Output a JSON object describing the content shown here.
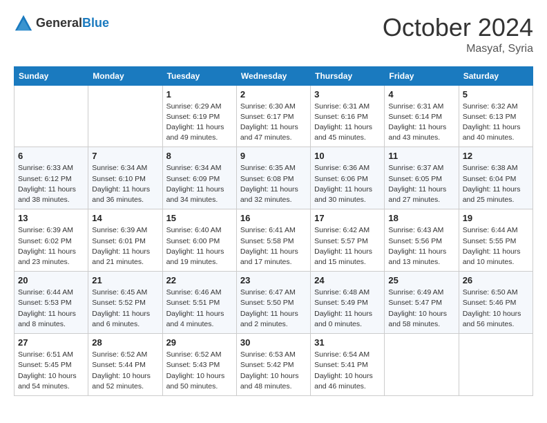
{
  "logo": {
    "general": "General",
    "blue": "Blue"
  },
  "title": "October 2024",
  "location": "Masyaf, Syria",
  "weekdays": [
    "Sunday",
    "Monday",
    "Tuesday",
    "Wednesday",
    "Thursday",
    "Friday",
    "Saturday"
  ],
  "weeks": [
    [
      {
        "day": "",
        "sunrise": "",
        "sunset": "",
        "daylight": ""
      },
      {
        "day": "",
        "sunrise": "",
        "sunset": "",
        "daylight": ""
      },
      {
        "day": "1",
        "sunrise": "Sunrise: 6:29 AM",
        "sunset": "Sunset: 6:19 PM",
        "daylight": "Daylight: 11 hours and 49 minutes."
      },
      {
        "day": "2",
        "sunrise": "Sunrise: 6:30 AM",
        "sunset": "Sunset: 6:17 PM",
        "daylight": "Daylight: 11 hours and 47 minutes."
      },
      {
        "day": "3",
        "sunrise": "Sunrise: 6:31 AM",
        "sunset": "Sunset: 6:16 PM",
        "daylight": "Daylight: 11 hours and 45 minutes."
      },
      {
        "day": "4",
        "sunrise": "Sunrise: 6:31 AM",
        "sunset": "Sunset: 6:14 PM",
        "daylight": "Daylight: 11 hours and 43 minutes."
      },
      {
        "day": "5",
        "sunrise": "Sunrise: 6:32 AM",
        "sunset": "Sunset: 6:13 PM",
        "daylight": "Daylight: 11 hours and 40 minutes."
      }
    ],
    [
      {
        "day": "6",
        "sunrise": "Sunrise: 6:33 AM",
        "sunset": "Sunset: 6:12 PM",
        "daylight": "Daylight: 11 hours and 38 minutes."
      },
      {
        "day": "7",
        "sunrise": "Sunrise: 6:34 AM",
        "sunset": "Sunset: 6:10 PM",
        "daylight": "Daylight: 11 hours and 36 minutes."
      },
      {
        "day": "8",
        "sunrise": "Sunrise: 6:34 AM",
        "sunset": "Sunset: 6:09 PM",
        "daylight": "Daylight: 11 hours and 34 minutes."
      },
      {
        "day": "9",
        "sunrise": "Sunrise: 6:35 AM",
        "sunset": "Sunset: 6:08 PM",
        "daylight": "Daylight: 11 hours and 32 minutes."
      },
      {
        "day": "10",
        "sunrise": "Sunrise: 6:36 AM",
        "sunset": "Sunset: 6:06 PM",
        "daylight": "Daylight: 11 hours and 30 minutes."
      },
      {
        "day": "11",
        "sunrise": "Sunrise: 6:37 AM",
        "sunset": "Sunset: 6:05 PM",
        "daylight": "Daylight: 11 hours and 27 minutes."
      },
      {
        "day": "12",
        "sunrise": "Sunrise: 6:38 AM",
        "sunset": "Sunset: 6:04 PM",
        "daylight": "Daylight: 11 hours and 25 minutes."
      }
    ],
    [
      {
        "day": "13",
        "sunrise": "Sunrise: 6:39 AM",
        "sunset": "Sunset: 6:02 PM",
        "daylight": "Daylight: 11 hours and 23 minutes."
      },
      {
        "day": "14",
        "sunrise": "Sunrise: 6:39 AM",
        "sunset": "Sunset: 6:01 PM",
        "daylight": "Daylight: 11 hours and 21 minutes."
      },
      {
        "day": "15",
        "sunrise": "Sunrise: 6:40 AM",
        "sunset": "Sunset: 6:00 PM",
        "daylight": "Daylight: 11 hours and 19 minutes."
      },
      {
        "day": "16",
        "sunrise": "Sunrise: 6:41 AM",
        "sunset": "Sunset: 5:58 PM",
        "daylight": "Daylight: 11 hours and 17 minutes."
      },
      {
        "day": "17",
        "sunrise": "Sunrise: 6:42 AM",
        "sunset": "Sunset: 5:57 PM",
        "daylight": "Daylight: 11 hours and 15 minutes."
      },
      {
        "day": "18",
        "sunrise": "Sunrise: 6:43 AM",
        "sunset": "Sunset: 5:56 PM",
        "daylight": "Daylight: 11 hours and 13 minutes."
      },
      {
        "day": "19",
        "sunrise": "Sunrise: 6:44 AM",
        "sunset": "Sunset: 5:55 PM",
        "daylight": "Daylight: 11 hours and 10 minutes."
      }
    ],
    [
      {
        "day": "20",
        "sunrise": "Sunrise: 6:44 AM",
        "sunset": "Sunset: 5:53 PM",
        "daylight": "Daylight: 11 hours and 8 minutes."
      },
      {
        "day": "21",
        "sunrise": "Sunrise: 6:45 AM",
        "sunset": "Sunset: 5:52 PM",
        "daylight": "Daylight: 11 hours and 6 minutes."
      },
      {
        "day": "22",
        "sunrise": "Sunrise: 6:46 AM",
        "sunset": "Sunset: 5:51 PM",
        "daylight": "Daylight: 11 hours and 4 minutes."
      },
      {
        "day": "23",
        "sunrise": "Sunrise: 6:47 AM",
        "sunset": "Sunset: 5:50 PM",
        "daylight": "Daylight: 11 hours and 2 minutes."
      },
      {
        "day": "24",
        "sunrise": "Sunrise: 6:48 AM",
        "sunset": "Sunset: 5:49 PM",
        "daylight": "Daylight: 11 hours and 0 minutes."
      },
      {
        "day": "25",
        "sunrise": "Sunrise: 6:49 AM",
        "sunset": "Sunset: 5:47 PM",
        "daylight": "Daylight: 10 hours and 58 minutes."
      },
      {
        "day": "26",
        "sunrise": "Sunrise: 6:50 AM",
        "sunset": "Sunset: 5:46 PM",
        "daylight": "Daylight: 10 hours and 56 minutes."
      }
    ],
    [
      {
        "day": "27",
        "sunrise": "Sunrise: 6:51 AM",
        "sunset": "Sunset: 5:45 PM",
        "daylight": "Daylight: 10 hours and 54 minutes."
      },
      {
        "day": "28",
        "sunrise": "Sunrise: 6:52 AM",
        "sunset": "Sunset: 5:44 PM",
        "daylight": "Daylight: 10 hours and 52 minutes."
      },
      {
        "day": "29",
        "sunrise": "Sunrise: 6:52 AM",
        "sunset": "Sunset: 5:43 PM",
        "daylight": "Daylight: 10 hours and 50 minutes."
      },
      {
        "day": "30",
        "sunrise": "Sunrise: 6:53 AM",
        "sunset": "Sunset: 5:42 PM",
        "daylight": "Daylight: 10 hours and 48 minutes."
      },
      {
        "day": "31",
        "sunrise": "Sunrise: 6:54 AM",
        "sunset": "Sunset: 5:41 PM",
        "daylight": "Daylight: 10 hours and 46 minutes."
      },
      {
        "day": "",
        "sunrise": "",
        "sunset": "",
        "daylight": ""
      },
      {
        "day": "",
        "sunrise": "",
        "sunset": "",
        "daylight": ""
      }
    ]
  ]
}
